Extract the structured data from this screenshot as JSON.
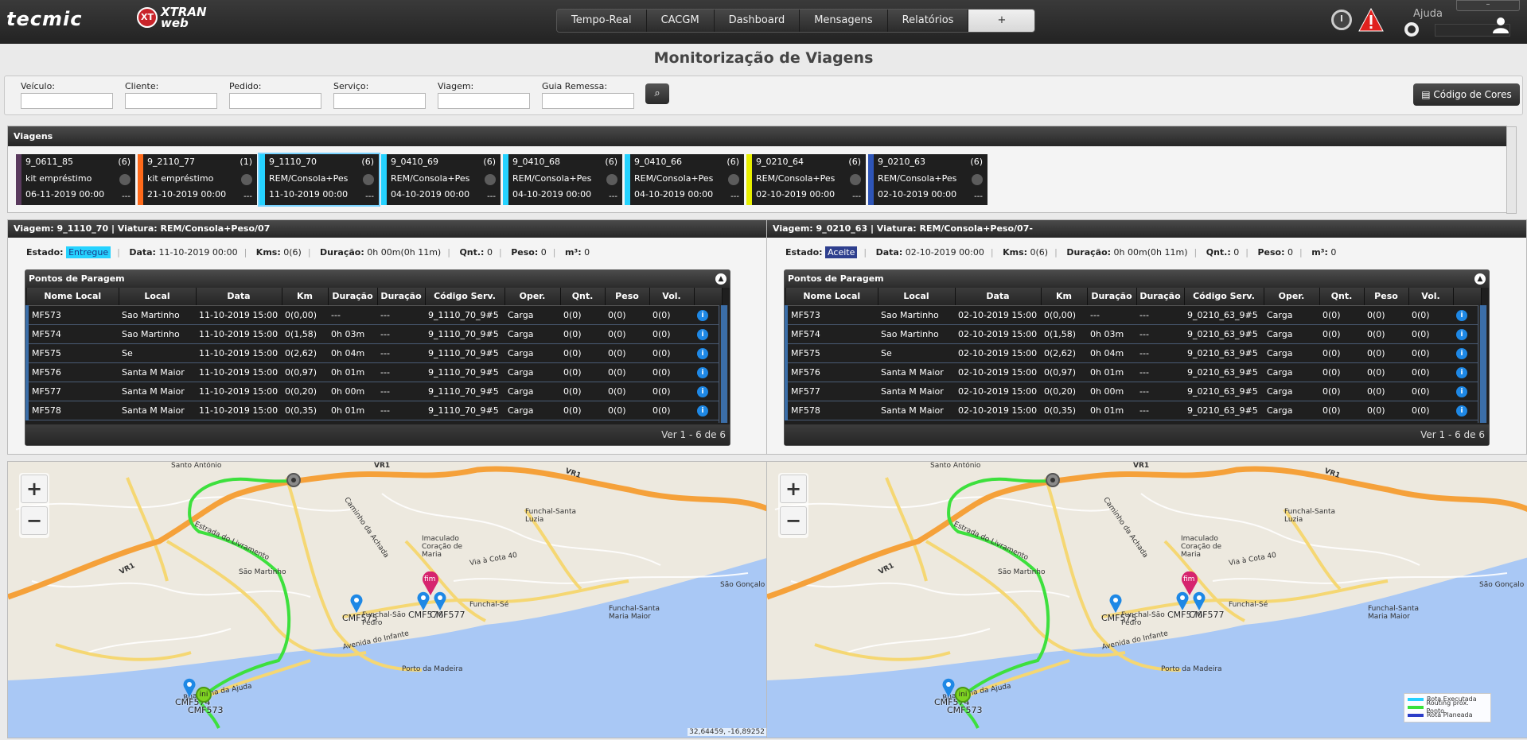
{
  "header": {
    "logo": "tecmic",
    "product_badge": "XT",
    "product_line1": "XTRAN",
    "product_line2": "web",
    "nav": [
      "Tempo-Real",
      "CACGM",
      "Dashboard",
      "Mensagens",
      "Relatórios",
      "+"
    ],
    "help": "Ajuda",
    "window_btn": "–",
    "icons": [
      "alarm-clock-icon",
      "warning-icon",
      "lifebuoy-icon",
      "user-icon"
    ]
  },
  "page_title": "Monitorização de Viagens",
  "filters": {
    "fields": [
      {
        "label": "Veículo:",
        "value": ""
      },
      {
        "label": "Cliente:",
        "value": ""
      },
      {
        "label": "Pedido:",
        "value": ""
      },
      {
        "label": "Serviço:",
        "value": ""
      },
      {
        "label": "Viagem:",
        "value": ""
      },
      {
        "label": "Guia Remessa:",
        "value": ""
      }
    ],
    "search_icon": "⌕",
    "colors_button": "Código de Cores"
  },
  "trips": {
    "title": "Viagens",
    "items": [
      {
        "code": "9_0611_85",
        "count": "(6)",
        "desc": "kit empréstimo",
        "date": "06-11-2019 00:00",
        "dash": "---",
        "color": "#5a3a5e"
      },
      {
        "code": "9_2110_77",
        "count": "(1)",
        "desc": "kit empréstimo",
        "date": "21-10-2019 00:00",
        "dash": "---",
        "color": "#ff6a1a"
      },
      {
        "code": "9_1110_70",
        "count": "(6)",
        "desc": "REM/Consola+Pes",
        "date": "11-10-2019 00:00",
        "dash": "---",
        "color": "#25d2ff"
      },
      {
        "code": "9_0410_69",
        "count": "(6)",
        "desc": "REM/Consola+Pes",
        "date": "04-10-2019 00:00",
        "dash": "---",
        "color": "#25d2ff"
      },
      {
        "code": "9_0410_68",
        "count": "(6)",
        "desc": "REM/Consola+Pes",
        "date": "04-10-2019 00:00",
        "dash": "---",
        "color": "#25d2ff"
      },
      {
        "code": "9_0410_66",
        "count": "(6)",
        "desc": "REM/Consola+Pes",
        "date": "04-10-2019 00:00",
        "dash": "---",
        "color": "#25d2ff"
      },
      {
        "code": "9_0210_64",
        "count": "(6)",
        "desc": "REM/Consola+Pes",
        "date": "02-10-2019 00:00",
        "dash": "---",
        "color": "#e8f000"
      },
      {
        "code": "9_0210_63",
        "count": "(6)",
        "desc": "REM/Consola+Pes",
        "date": "02-10-2019 00:00",
        "dash": "---",
        "color": "#2e55b8"
      }
    ]
  },
  "details": [
    {
      "title": "Viagem: 9_1110_70 | Viatura: REM/Consola+Peso/07",
      "estado_label": "Estado:",
      "estado": "Entregue",
      "estado_bg": "#25d2ff",
      "estado_fg": "#1a3a8a",
      "data_label": "Data:",
      "data": "11-10-2019 00:00",
      "kms_label": "Kms:",
      "kms": "0(6)",
      "duracao_label": "Duração:",
      "duracao": "0h 00m(0h 11m)",
      "qnt_label": "Qnt.:",
      "qnt": "0",
      "peso_label": "Peso:",
      "peso": "0",
      "m3_label": "m³:",
      "m3": "0",
      "stops_title": "Pontos de Paragem",
      "columns": [
        "Nome Local",
        "Local",
        "Data",
        "Km",
        "Duração",
        "Duração",
        "Código Serv.",
        "Oper.",
        "Qnt.",
        "Peso",
        "Vol.",
        ""
      ],
      "rows": [
        [
          "MF573",
          "Sao Martinho",
          "11-10-2019 15:00",
          "0(0,00)",
          "---",
          "---",
          "9_1110_70_9#5",
          "Carga",
          "0(0)",
          "0(0)",
          "0(0)"
        ],
        [
          "MF574",
          "Sao Martinho",
          "11-10-2019 15:00",
          "0(1,58)",
          "0h 03m",
          "---",
          "9_1110_70_9#5",
          "Carga",
          "0(0)",
          "0(0)",
          "0(0)"
        ],
        [
          "MF575",
          "Se",
          "11-10-2019 15:00",
          "0(2,62)",
          "0h 04m",
          "---",
          "9_1110_70_9#5",
          "Carga",
          "0(0)",
          "0(0)",
          "0(0)"
        ],
        [
          "MF576",
          "Santa M Maior",
          "11-10-2019 15:00",
          "0(0,97)",
          "0h 01m",
          "---",
          "9_1110_70_9#5",
          "Carga",
          "0(0)",
          "0(0)",
          "0(0)"
        ],
        [
          "MF577",
          "Santa M Maior",
          "11-10-2019 15:00",
          "0(0,20)",
          "0h 00m",
          "---",
          "9_1110_70_9#5",
          "Carga",
          "0(0)",
          "0(0)",
          "0(0)"
        ],
        [
          "MF578",
          "Santa M Maior",
          "11-10-2019 15:00",
          "0(0,35)",
          "0h 01m",
          "---",
          "9_1110_70_9#5",
          "Carga",
          "0(0)",
          "0(0)",
          "0(0)"
        ]
      ],
      "footer": "Ver 1 - 6 de 6"
    },
    {
      "title": "Viagem: 9_0210_63 | Viatura: REM/Consola+Peso/07-",
      "estado_label": "Estado:",
      "estado": "Aceite",
      "estado_bg": "#2e3f8e",
      "estado_fg": "#ffffff",
      "data_label": "Data:",
      "data": "02-10-2019 00:00",
      "kms_label": "Kms:",
      "kms": "0(6)",
      "duracao_label": "Duração:",
      "duracao": "0h 00m(0h 11m)",
      "qnt_label": "Qnt.:",
      "qnt": "0",
      "peso_label": "Peso:",
      "peso": "0",
      "m3_label": "m³:",
      "m3": "0",
      "stops_title": "Pontos de Paragem",
      "columns": [
        "Nome Local",
        "Local",
        "Data",
        "Km",
        "Duração",
        "Duração",
        "Código Serv.",
        "Oper.",
        "Qnt.",
        "Peso",
        "Vol.",
        ""
      ],
      "rows": [
        [
          "MF573",
          "Sao Martinho",
          "02-10-2019 15:00",
          "0(0,00)",
          "---",
          "---",
          "9_0210_63_9#5",
          "Carga",
          "0(0)",
          "0(0)",
          "0(0)"
        ],
        [
          "MF574",
          "Sao Martinho",
          "02-10-2019 15:00",
          "0(1,58)",
          "0h 03m",
          "---",
          "9_0210_63_9#5",
          "Carga",
          "0(0)",
          "0(0)",
          "0(0)"
        ],
        [
          "MF575",
          "Se",
          "02-10-2019 15:00",
          "0(2,62)",
          "0h 04m",
          "---",
          "9_0210_63_9#5",
          "Carga",
          "0(0)",
          "0(0)",
          "0(0)"
        ],
        [
          "MF576",
          "Santa M Maior",
          "02-10-2019 15:00",
          "0(0,97)",
          "0h 01m",
          "---",
          "9_0210_63_9#5",
          "Carga",
          "0(0)",
          "0(0)",
          "0(0)"
        ],
        [
          "MF577",
          "Santa M Maior",
          "02-10-2019 15:00",
          "0(0,20)",
          "0h 00m",
          "---",
          "9_0210_63_9#5",
          "Carga",
          "0(0)",
          "0(0)",
          "0(0)"
        ],
        [
          "MF578",
          "Santa M Maior",
          "02-10-2019 15:00",
          "0(0,35)",
          "0h 01m",
          "---",
          "9_0210_63_9#5",
          "Carga",
          "0(0)",
          "0(0)",
          "0(0)"
        ]
      ],
      "footer": "Ver 1 - 6 de 6"
    }
  ],
  "maps": {
    "zoom_in": "+",
    "zoom_out": "−",
    "place_labels": [
      "Santo António",
      "São Martinho",
      "Caminho da Achada",
      "Imaculado Coração de Maria",
      "Via à Cota 40",
      "Funchal-Santa Luzia",
      "Funchal-São Pedro",
      "Funchal-Sé",
      "Avenida do Infante",
      "Porto da Madeira",
      "Funchal-Santa Maria Maior",
      "São Gonçalo",
      "Rua Velha da Ajuda",
      "Estrada do Livramento"
    ],
    "road_labels": [
      "VR1"
    ],
    "markers": {
      "start": "ini",
      "end": "fim",
      "cmf575": "CMF575",
      "cmf576_577": "CMF577",
      "cmf576": "CMF576",
      "cmf573": "CMF573",
      "cmf574": "CMF574"
    },
    "coords": "32,64459, -16,89252",
    "legend": [
      {
        "label": "Rota Executada",
        "color": "#25d2ff"
      },
      {
        "label": "Routing próx. Ponto",
        "color": "#39e139"
      },
      {
        "label": "Rota Planeada",
        "color": "#2a3cc8"
      }
    ]
  }
}
